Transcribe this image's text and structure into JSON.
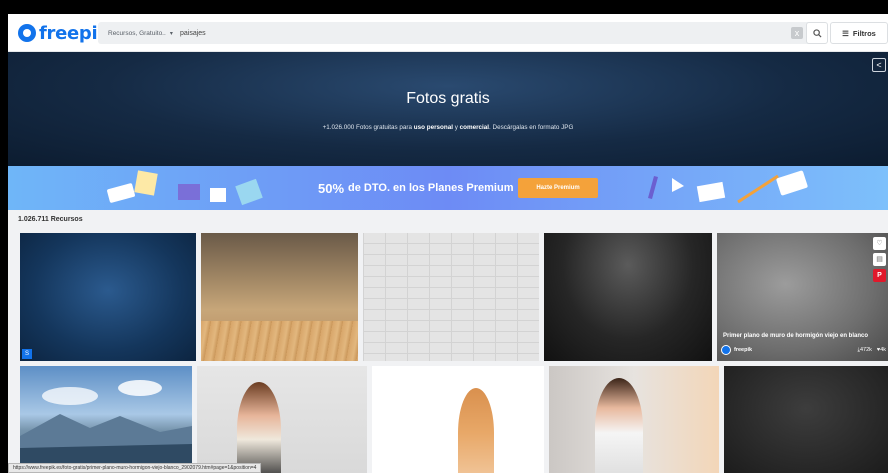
{
  "header": {
    "logo_text": "freepik",
    "scope_label": "Recursos, Gratuito..",
    "scope_caret": "▾",
    "search_value": "paisajes",
    "clear_icon": "x",
    "search_icon_glyph": "🔍",
    "filter_icon_glyph": "☰",
    "filter_label": "Filtros"
  },
  "hero": {
    "title": "Fotos gratis",
    "subtitle_pre": "+1.026.000 Fotos gratuitas para ",
    "subtitle_bold1": "uso personal",
    "subtitle_mid": " y ",
    "subtitle_bold2": "comercial",
    "subtitle_post": ". Descárgalas en formato JPG",
    "share_glyph": "<"
  },
  "promo": {
    "discount": "50%",
    "text": "de DTO. en los Planes Premium",
    "button": "Hazte Premium",
    "accent": "#f4a23a"
  },
  "results": {
    "count": "1.026.711 Recursos",
    "featured": {
      "caption": "Primer plano de muro de hormigón viejo en blanco",
      "author": "freepik",
      "downloads": "472k",
      "likes": "4k",
      "download_glyph": "⤓",
      "like_glyph": "♥",
      "heart_glyph": "♡",
      "collection_glyph": "▤",
      "pin_glyph": "P"
    },
    "badge_glyph": "S"
  },
  "status_url": "https://www.freepik.es/foto-gratis/primer-plano-muro-hormigon-viejo-blanco_2902079.htm#page=1&position=4",
  "colors": {
    "brand": "#1273eb",
    "hero_bg": "#152a44",
    "pinterest": "#e0192b"
  }
}
